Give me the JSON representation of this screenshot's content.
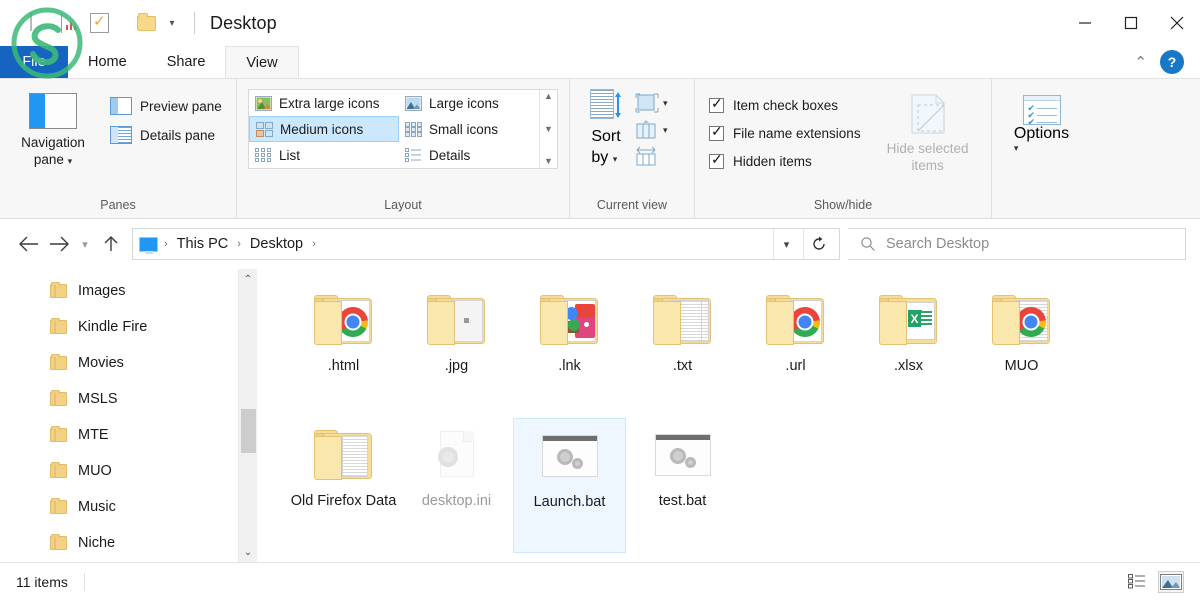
{
  "window": {
    "title": "Desktop",
    "controls": {
      "minimize": "minimize-button",
      "maximize": "maximize-button",
      "close": "close-button"
    }
  },
  "quick_access": {
    "items": [
      "blue-square-icon",
      "chart-icon",
      "checkmark-icon",
      "folder-icon"
    ],
    "dropdown": "▾"
  },
  "tabs": [
    {
      "label": "File",
      "active": false
    },
    {
      "label": "Home",
      "active": false
    },
    {
      "label": "Share",
      "active": false
    },
    {
      "label": "View",
      "active": true
    }
  ],
  "ribbon_right": {
    "collapse": "⌃",
    "help": "?"
  },
  "ribbon": {
    "groups": [
      {
        "label": "Panes",
        "big": {
          "label_line1": "Navigation",
          "label_line2": "pane"
        },
        "small": [
          {
            "label": "Preview pane"
          },
          {
            "label": "Details pane"
          }
        ]
      },
      {
        "label": "Layout",
        "items": [
          {
            "label": "Extra large icons",
            "selected": false
          },
          {
            "label": "Large icons",
            "selected": false
          },
          {
            "label": "Medium icons",
            "selected": true
          },
          {
            "label": "Small icons",
            "selected": false
          },
          {
            "label": "List",
            "selected": false
          },
          {
            "label": "Details",
            "selected": false
          }
        ]
      },
      {
        "label": "Current view",
        "sort": {
          "line1": "Sort",
          "line2": "by"
        },
        "buttons": [
          "group-by-icon",
          "add-columns-icon",
          "size-all-columns-icon"
        ]
      },
      {
        "label": "Show/hide",
        "checkboxes": [
          {
            "label": "Item check boxes",
            "checked": true
          },
          {
            "label": "File name extensions",
            "checked": true
          },
          {
            "label": "Hidden items",
            "checked": true
          }
        ],
        "hide_selected": {
          "line1": "Hide selected",
          "line2": "items",
          "disabled": true
        }
      },
      {
        "label": "",
        "options": {
          "label": "Options"
        }
      }
    ]
  },
  "address": {
    "back": "←",
    "forward": "→",
    "recent": "▾",
    "up": "↑",
    "crumbs": [
      "This PC",
      "Desktop"
    ],
    "separator": "›",
    "dropdown": "▾",
    "refresh": "↻"
  },
  "search": {
    "placeholder": "Search Desktop"
  },
  "sidebar": {
    "items": [
      {
        "label": "Images"
      },
      {
        "label": "Kindle Fire"
      },
      {
        "label": "Movies"
      },
      {
        "label": "MSLS"
      },
      {
        "label": "MTE"
      },
      {
        "label": "MUO"
      },
      {
        "label": "Music"
      },
      {
        "label": "Niche"
      }
    ],
    "scroll_up": "⌃",
    "scroll_down": "⌄"
  },
  "files": [
    {
      "name": ".html",
      "kind": "folder",
      "overlay": "chrome",
      "selected": false,
      "hidden": false
    },
    {
      "name": ".jpg",
      "kind": "folder",
      "overlay": "image",
      "selected": false,
      "hidden": false
    },
    {
      "name": ".lnk",
      "kind": "folder",
      "overlay": "mixed",
      "selected": false,
      "hidden": false
    },
    {
      "name": ".txt",
      "kind": "folder",
      "overlay": "text",
      "selected": false,
      "hidden": false
    },
    {
      "name": ".url",
      "kind": "folder",
      "overlay": "chrome",
      "selected": false,
      "hidden": false
    },
    {
      "name": ".xlsx",
      "kind": "folder",
      "overlay": "excel",
      "selected": false,
      "hidden": false
    },
    {
      "name": "MUO",
      "kind": "folder",
      "overlay": "chrome",
      "selected": false,
      "hidden": false
    },
    {
      "name": "Old Firefox Data",
      "kind": "folder",
      "overlay": "text",
      "selected": false,
      "hidden": false
    },
    {
      "name": "desktop.ini",
      "kind": "ini",
      "overlay": "none",
      "selected": false,
      "hidden": true
    },
    {
      "name": "Launch.bat",
      "kind": "bat",
      "overlay": "none",
      "selected": true,
      "hidden": false
    },
    {
      "name": "test.bat",
      "kind": "bat",
      "overlay": "none",
      "selected": false,
      "hidden": false
    }
  ],
  "status": {
    "item_count": "11 items",
    "view_details": "details-view-icon",
    "view_large": "large-icons-view-icon"
  },
  "colors": {
    "accent": "#1565c0",
    "selection": "#cce8ff",
    "folder": "#f7dd9a",
    "ribbon_bg": "#f7f7f7"
  }
}
